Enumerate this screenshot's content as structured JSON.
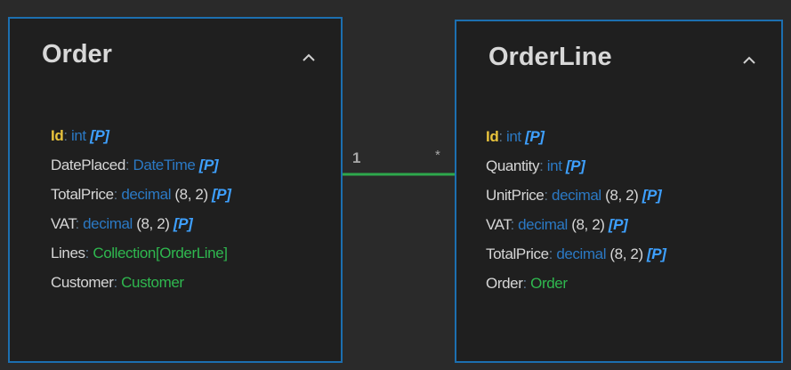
{
  "entities": [
    {
      "name": "Order",
      "fields": [
        {
          "name": "Id",
          "separator": ":",
          "type": "int",
          "precision": "",
          "flag": "[P]",
          "kind": "scalar",
          "pk": true
        },
        {
          "name": "DatePlaced",
          "separator": ":",
          "type": "DateTime",
          "precision": "",
          "flag": "[P]",
          "kind": "scalar",
          "pk": false
        },
        {
          "name": "TotalPrice",
          "separator": ":",
          "type": "decimal",
          "precision": "(8, 2)",
          "flag": "[P]",
          "kind": "scalar",
          "pk": false
        },
        {
          "name": "VAT",
          "separator": ":",
          "type": "decimal",
          "precision": "(8, 2)",
          "flag": "[P]",
          "kind": "scalar",
          "pk": false
        },
        {
          "name": "Lines",
          "separator": ":",
          "type": "Collection[OrderLine]",
          "precision": "",
          "flag": "",
          "kind": "nav",
          "pk": false
        },
        {
          "name": "Customer",
          "separator": ":",
          "type": "Customer",
          "precision": "",
          "flag": "",
          "kind": "nav",
          "pk": false
        }
      ]
    },
    {
      "name": "OrderLine",
      "fields": [
        {
          "name": "Id",
          "separator": ":",
          "type": "int",
          "precision": "",
          "flag": "[P]",
          "kind": "scalar",
          "pk": true
        },
        {
          "name": "Quantity",
          "separator": ":",
          "type": "int",
          "precision": "",
          "flag": "[P]",
          "kind": "scalar",
          "pk": false
        },
        {
          "name": "UnitPrice",
          "separator": ":",
          "type": "decimal",
          "precision": "(8, 2)",
          "flag": "[P]",
          "kind": "scalar",
          "pk": false
        },
        {
          "name": "VAT",
          "separator": ":",
          "type": "decimal",
          "precision": "(8, 2)",
          "flag": "[P]",
          "kind": "scalar",
          "pk": false
        },
        {
          "name": "TotalPrice",
          "separator": ":",
          "type": "decimal",
          "precision": "(8, 2)",
          "flag": "[P]",
          "kind": "scalar",
          "pk": false
        },
        {
          "name": "Order",
          "separator": ":",
          "type": "Order",
          "precision": "",
          "flag": "",
          "kind": "nav",
          "pk": false
        }
      ]
    }
  ],
  "relationship": {
    "from": "Order",
    "to": "OrderLine",
    "from_multiplicity": "1",
    "to_multiplicity": "*"
  },
  "icons": {
    "collapse": "chevron-up-icon"
  },
  "colors": {
    "background": "#2a2a2a",
    "panel": "#1f1f1f",
    "border": "#1c6fb0",
    "title": "#d8d8d8",
    "primary_key": "#e8c33c",
    "type": "#2b79c4",
    "navigation_type": "#2fb84f",
    "flag": "#3ea0ff",
    "connector": "#2ea84c"
  }
}
